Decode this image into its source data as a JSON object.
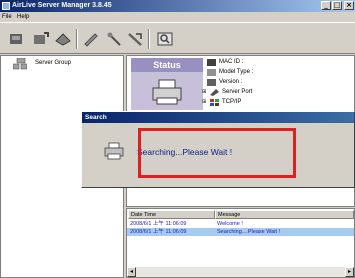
{
  "window": {
    "title": "AirLive Server Manager 3.8.45",
    "controls": [
      "_",
      "□",
      "×"
    ]
  },
  "menu": {
    "items": [
      "File",
      "Help"
    ]
  },
  "toolbar": {
    "icons": [
      "discover-icon",
      "add-server-icon",
      "connect-icon",
      "configure-icon",
      "wizard-icon",
      "tools-icon",
      "about-icon"
    ]
  },
  "tree": {
    "root": "Server Group"
  },
  "status": {
    "label": "Status",
    "properties": [
      {
        "icon": "mac-icon",
        "label": "MAC ID :"
      },
      {
        "icon": "model-icon",
        "label": "Model Type :"
      },
      {
        "icon": "version-icon",
        "label": "Version :"
      },
      {
        "icon": "server-port-icon",
        "label": "Server Port"
      },
      {
        "icon": "tcpip-icon",
        "label": "TCP/IP"
      }
    ]
  },
  "log": {
    "columns": [
      "Date Time",
      "Message"
    ],
    "rows": [
      {
        "datetime": "2008/6/1 上午 11:06:09",
        "message": "Welcome !"
      },
      {
        "datetime": "2008/6/1 上午 11:06:09",
        "message": "Searching....Please Wait !"
      }
    ]
  },
  "dialog": {
    "title": "Search",
    "message": "Searching...Please Wait !"
  },
  "colors": {
    "highlight": "#e02020",
    "titlebar": "#0a246a",
    "status_accent": "#9890c0"
  }
}
